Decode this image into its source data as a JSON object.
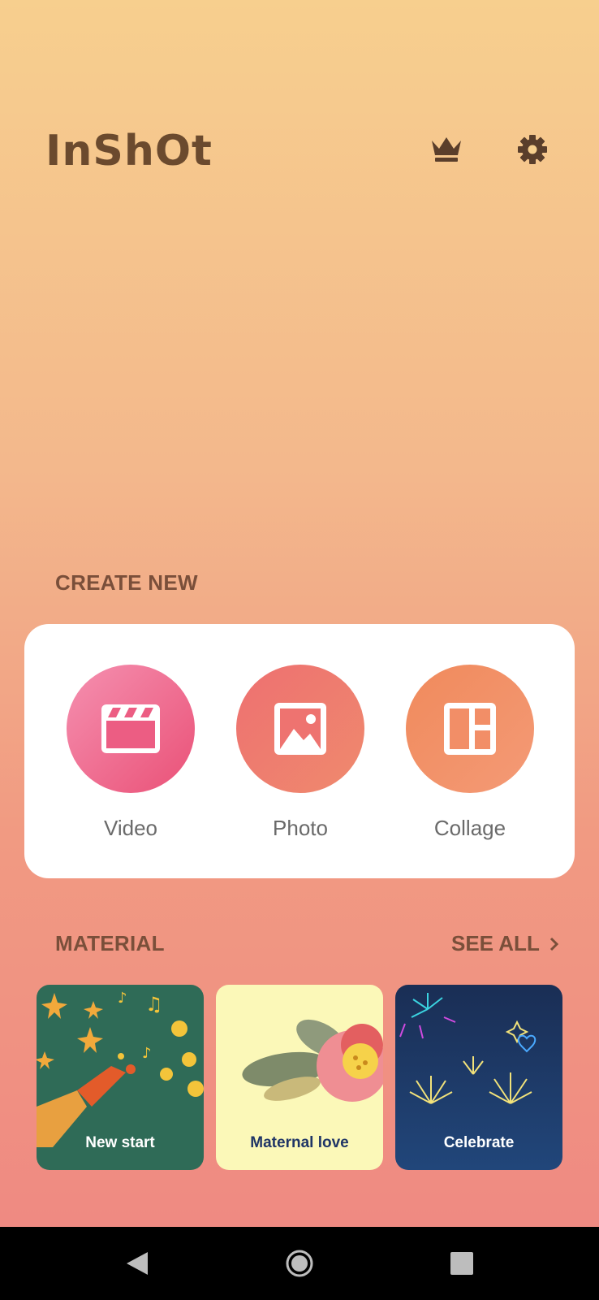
{
  "app": {
    "logo_text": "InShOt"
  },
  "header": {
    "icons": [
      "crown-icon",
      "gear-icon"
    ]
  },
  "create_new": {
    "title": "CREATE NEW",
    "tools": [
      {
        "label": "Video",
        "icon": "clapperboard-icon"
      },
      {
        "label": "Photo",
        "icon": "image-icon"
      },
      {
        "label": "Collage",
        "icon": "collage-layout-icon"
      }
    ]
  },
  "material": {
    "title": "MATERIAL",
    "see_all": "SEE ALL",
    "items": [
      {
        "label": "New start"
      },
      {
        "label": "Maternal love"
      },
      {
        "label": "Celebrate"
      }
    ]
  },
  "nav": {
    "buttons": [
      "back-icon",
      "home-icon",
      "recent-apps-icon"
    ]
  },
  "colors": {
    "text_brown": "#7a4f3a",
    "logo_brown": "#6b4a2e",
    "video": "#ea5177",
    "photo": "#ee7070",
    "collage": "#f08a5c"
  }
}
